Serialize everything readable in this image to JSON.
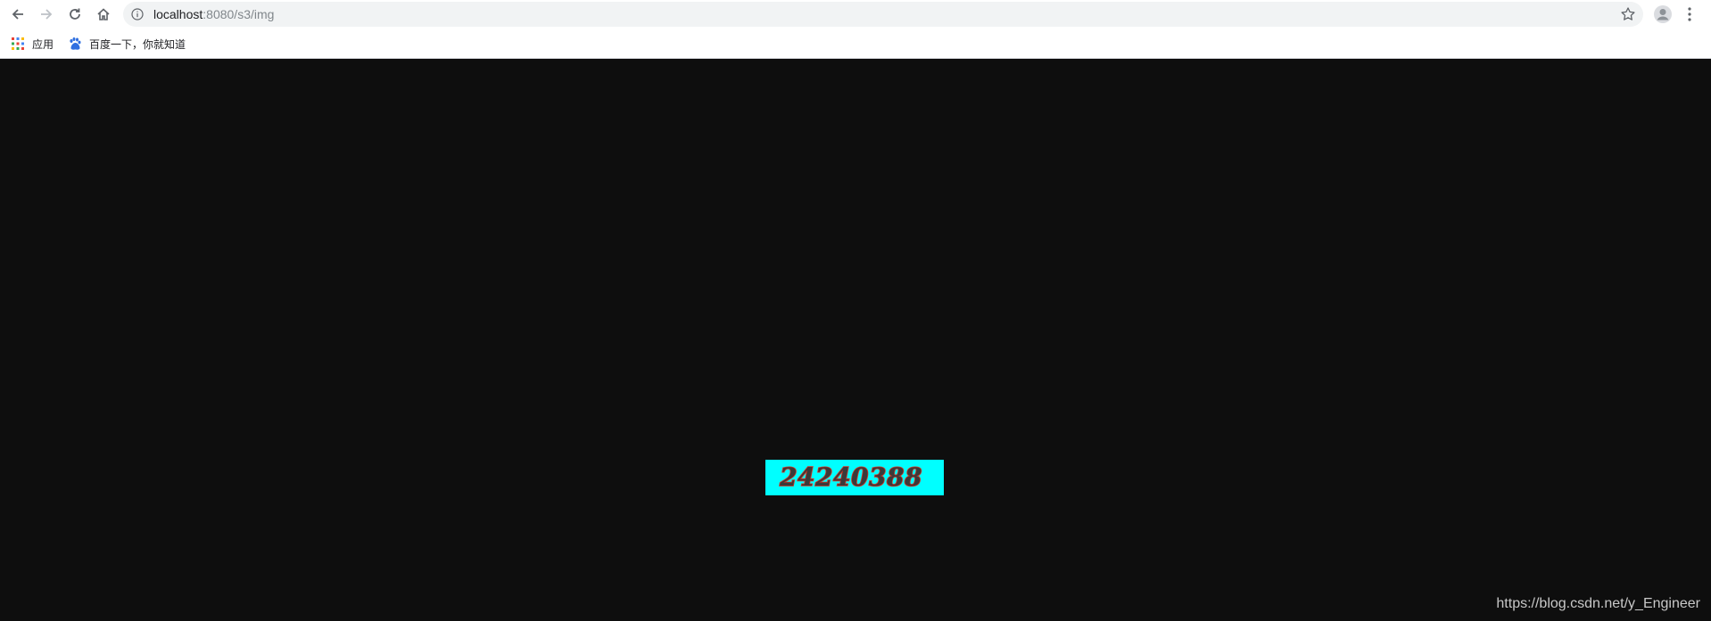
{
  "browser": {
    "url_host": "localhost",
    "url_path": ":8080/s3/img",
    "icons": {
      "back": "arrow-left-icon",
      "forward": "arrow-right-icon",
      "reload": "reload-icon",
      "home": "home-icon",
      "info": "info-icon",
      "star": "star-icon",
      "avatar": "avatar-icon",
      "menu": "kebab-menu-icon"
    }
  },
  "bookmarks": [
    {
      "label": "应用",
      "icon": "apps-grid-icon"
    },
    {
      "label": "百度一下，你就知道",
      "icon": "baidu-paw-icon"
    }
  ],
  "page": {
    "captcha_text": "24240388",
    "captcha_bg": "#00ffff",
    "captcha_fill": "#3a3a3a",
    "captcha_stroke": "#e03020"
  },
  "watermark": "https://blog.csdn.net/y_Engineer",
  "colors": {
    "page_bg": "#0e0e0e",
    "toolbar_bg": "#ffffff",
    "omnibox_bg": "#f1f3f4"
  }
}
